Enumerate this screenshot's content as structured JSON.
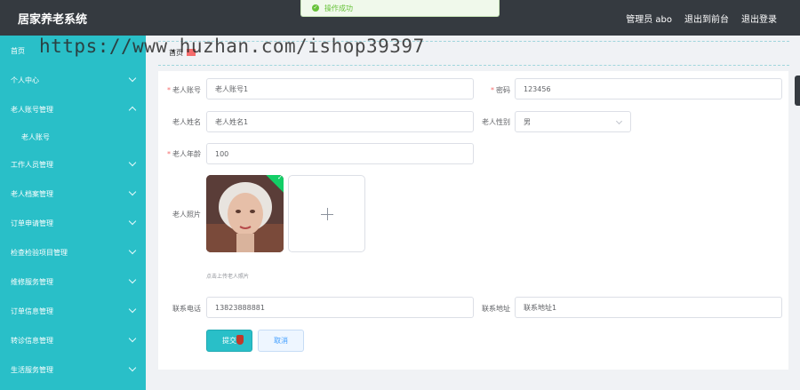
{
  "header": {
    "app_title": "居家养老系统",
    "user_label": "管理员 abo",
    "exit_frontend": "退出到前台",
    "logout": "退出登录"
  },
  "toast": {
    "message": "操作成功",
    "icon": "success-check-icon",
    "color": "#67c23a"
  },
  "watermark": "https://www.huzhan.com/ishop39397",
  "sidebar": {
    "background": "#29bfc8",
    "items": [
      {
        "label": "首页",
        "expandable": false
      },
      {
        "label": "个人中心",
        "expandable": true
      },
      {
        "label": "老人账号管理",
        "expandable": true,
        "expanded": true
      },
      {
        "label": "老人账号",
        "sub": true
      },
      {
        "label": "工作人员管理",
        "expandable": true
      },
      {
        "label": "老人档案管理",
        "expandable": true
      },
      {
        "label": "订单申请管理",
        "expandable": true
      },
      {
        "label": "检查检验项目管理",
        "expandable": true
      },
      {
        "label": "维修服务管理",
        "expandable": true
      },
      {
        "label": "订单信息管理",
        "expandable": true
      },
      {
        "label": "转诊信息管理",
        "expandable": true
      },
      {
        "label": "生活服务管理",
        "expandable": true
      }
    ]
  },
  "breadcrumb": {
    "home": "首页"
  },
  "form": {
    "account": {
      "label": "老人账号",
      "value": "老人账号1",
      "required": true
    },
    "password": {
      "label": "密码",
      "value": "123456",
      "required": true
    },
    "name": {
      "label": "老人姓名",
      "value": "老人姓名1"
    },
    "gender": {
      "label": "老人性别",
      "value": "男"
    },
    "age": {
      "label": "老人年龄",
      "value": "100",
      "required": true
    },
    "photo": {
      "label": "老人照片",
      "hint": "点击上传老人照片"
    },
    "phone": {
      "label": "联系电话",
      "value": "13823888881"
    },
    "address": {
      "label": "联系地址",
      "value": "联系地址1"
    },
    "submit": "提交",
    "cancel": "取消"
  }
}
